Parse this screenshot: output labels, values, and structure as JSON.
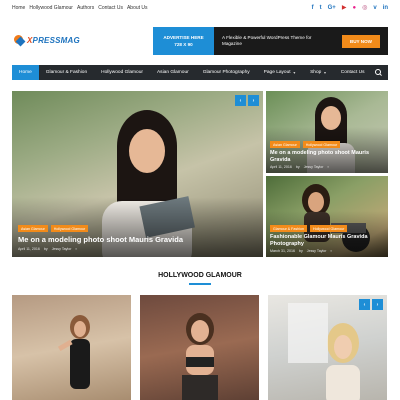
{
  "topbar": {
    "links": [
      "Home",
      "Hollywood Glamour",
      "Authors",
      "Contact Us",
      "About Us"
    ],
    "social_icons": [
      "facebook-icon",
      "twitter-icon",
      "google-plus-icon",
      "youtube-icon",
      "flickr-icon",
      "instagram-icon",
      "vimeo-icon",
      "linkedin-icon"
    ]
  },
  "logo": {
    "x": "X",
    "rest": "PRESSMAG"
  },
  "ad": {
    "left_line1": "ADVERTISE HERE",
    "left_line2": "728 X 90",
    "message": "A Flexible & Powerful WordPress Theme for Magazine",
    "cta": "BUY NOW"
  },
  "nav": {
    "items": [
      {
        "label": "Home",
        "active": true
      },
      {
        "label": "Glamour & Fashion"
      },
      {
        "label": "Hollywood Glamour"
      },
      {
        "label": "Asian Glamour"
      },
      {
        "label": "Glamour Photography"
      },
      {
        "label": "Page Layout",
        "dropdown": true
      },
      {
        "label": "Shop",
        "dropdown": true
      },
      {
        "label": "Contact Us"
      }
    ]
  },
  "hero": {
    "tags": [
      "Asian Glamour",
      "Hollywood Glamour"
    ],
    "title": "Me on a modeling photo shoot Mauris Gravida",
    "date": "April 11, 2016",
    "by": "by",
    "author": "Jessy Taylor",
    "prev": "‹",
    "next": "›"
  },
  "side1": {
    "tags": [
      "Asian Glamour",
      "Hollywood Glamour"
    ],
    "title": "Me on a modeling photo shoot Mauris Gravida",
    "date": "April 11, 2016",
    "by": "by",
    "author": "Jessy Taylor"
  },
  "side2": {
    "tags": [
      "Glamour & Fashion",
      "Hollywood Glamour"
    ],
    "title": "Fashionable Glamour Mauris Gravida Photography",
    "date": "March 31, 2016",
    "by": "by",
    "author": "Jessy Taylor"
  },
  "section": {
    "title": "HOLLYWOOD GLAMOUR",
    "prev": "‹",
    "next": "›"
  },
  "colors": {
    "accent": "#1e8ed6",
    "tag": "#f28b1a",
    "nav": "#262a2e"
  }
}
